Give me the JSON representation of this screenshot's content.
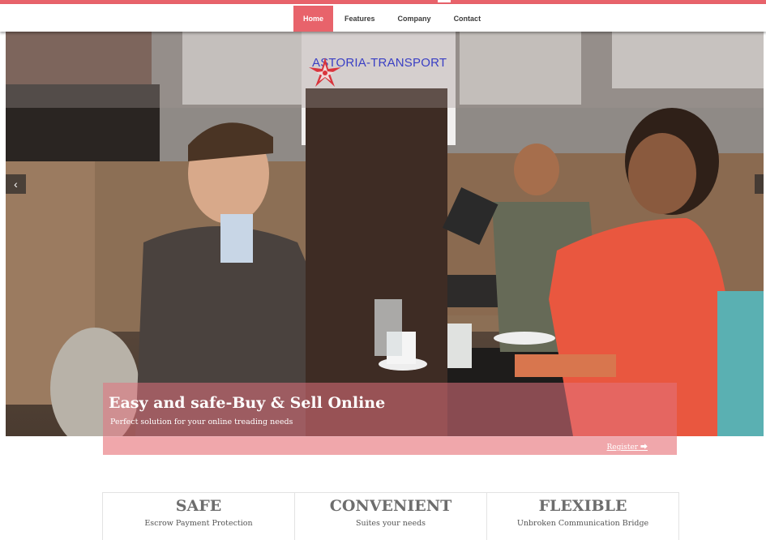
{
  "nav": {
    "items": [
      "Home",
      "Features",
      "Company",
      "Contact"
    ],
    "active": "Home"
  },
  "logo": {
    "text": "ASTORIA-TRANSPORT",
    "icon": "star-compass-logo"
  },
  "hero": {
    "title": "Easy and safe-Buy & Sell Online",
    "subtitle": "Perfect solution for your online treading needs",
    "register_label": "Register",
    "register_icon": "circle-arrow-right-icon",
    "prev_icon": "chevron-left-icon",
    "next_icon": "chevron-right-icon"
  },
  "features": [
    {
      "title": "SAFE",
      "subtitle": "Escrow Payment Protection"
    },
    {
      "title": "CONVENIENT",
      "subtitle": "Suites your needs"
    },
    {
      "title": "FLEXIBLE",
      "subtitle": "Unbroken Communication Bridge"
    }
  ],
  "colors": {
    "accent": "#e8636b",
    "caption_bg": "#e2737d",
    "register_bg": "#f0a7ab",
    "logo_text": "#3a3fc4"
  }
}
